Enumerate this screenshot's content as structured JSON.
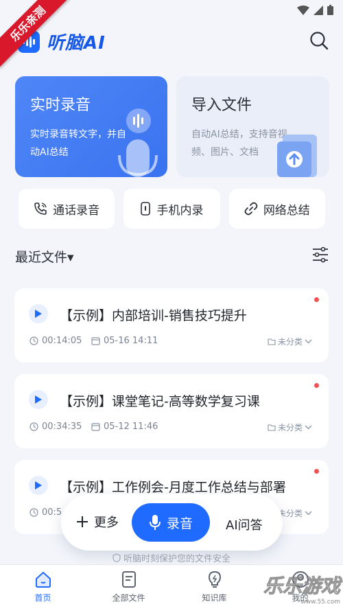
{
  "ribbon": "乐乐亲测",
  "app": {
    "name": "听脑AI"
  },
  "cards": {
    "realtime": {
      "title": "实时录音",
      "desc": "实时录音转文字，并自动AI总结"
    },
    "import": {
      "title": "导入文件",
      "desc": "自动AI总结，支持音视频、图片、文档"
    }
  },
  "quick": [
    {
      "label": "通话录音",
      "icon": "phone-icon"
    },
    {
      "label": "手机内录",
      "icon": "phone-record-icon"
    },
    {
      "label": "网络总结",
      "icon": "link-icon"
    }
  ],
  "recent": {
    "title": "最近文件▾"
  },
  "files": [
    {
      "title": "【示例】内部培训-销售技巧提升",
      "duration": "00:14:05",
      "date": "05-16 14:11",
      "category": "未分类"
    },
    {
      "title": "【示例】课堂笔记-高等数学复习课",
      "duration": "00:34:35",
      "date": "05-12 11:46",
      "category": "未分类"
    },
    {
      "title": "【示例】工作例会-月度工作总结与部署",
      "duration": "00:5",
      "date": "",
      "category": "未分类"
    }
  ],
  "actions": {
    "more": "更多",
    "record": "录音",
    "qa": "AI问答"
  },
  "safety": "听脑时刻保护您的文件安全",
  "tabs": [
    {
      "label": "首页",
      "icon": "home-icon"
    },
    {
      "label": "全部文件",
      "icon": "file-icon"
    },
    {
      "label": "知识库",
      "icon": "bulb-icon"
    },
    {
      "label": "我的",
      "icon": "user-icon"
    }
  ],
  "watermark": {
    "big": "乐乐游戏",
    "small": "www.55.com"
  },
  "colors": {
    "accent": "#1f6bff",
    "dot": "#ef5350"
  }
}
